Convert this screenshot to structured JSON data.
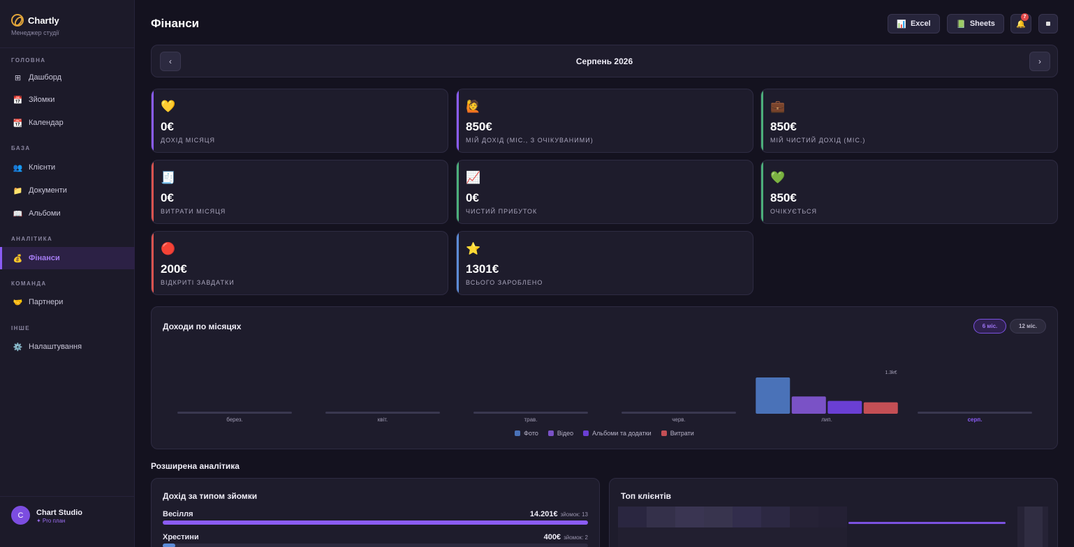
{
  "app": {
    "name": "Chartly",
    "subtitle": "Менеджер студії"
  },
  "nav": {
    "sections": [
      {
        "title": "ГОЛОВНА",
        "items": [
          {
            "key": "dashboard",
            "icon": "⊞",
            "label": "Дашборд"
          },
          {
            "key": "shoots",
            "icon": "📅",
            "label": "Зйомки"
          },
          {
            "key": "calendar",
            "icon": "📆",
            "label": "Календар"
          }
        ]
      },
      {
        "title": "БАЗА",
        "items": [
          {
            "key": "clients",
            "icon": "👥",
            "label": "Клієнти"
          },
          {
            "key": "documents",
            "icon": "📁",
            "label": "Документи"
          },
          {
            "key": "albums",
            "icon": "📖",
            "label": "Альбоми"
          }
        ]
      },
      {
        "title": "АНАЛІТИКА",
        "items": [
          {
            "key": "finance",
            "icon": "💰",
            "label": "Фінанси",
            "active": true
          }
        ]
      },
      {
        "title": "КОМАНДА",
        "items": [
          {
            "key": "partners",
            "icon": "🤝",
            "label": "Партнери"
          }
        ]
      },
      {
        "title": "ІНШЕ",
        "items": [
          {
            "key": "settings",
            "icon": "⚙️",
            "label": "Налаштування"
          }
        ]
      }
    ]
  },
  "user": {
    "initial": "C",
    "name": "Chart Studio",
    "plan": "✦ Pro план"
  },
  "header": {
    "title": "Фінанси",
    "excel_label": "Excel",
    "excel_icon": "📊",
    "sheets_label": "Sheets",
    "sheets_icon": "📗",
    "bell_icon": "🔔",
    "notif_count": "7"
  },
  "month": {
    "label": "Серпень 2026",
    "prev": "‹",
    "next": "›"
  },
  "stats": [
    {
      "emoji": "💛",
      "value": "0€",
      "label": "Дохід місяця",
      "accent": "#8b5cf6"
    },
    {
      "emoji": "🙋",
      "value": "850€",
      "label": "Мій дохід (міс., з очікуваними)",
      "accent": "#8b5cf6"
    },
    {
      "emoji": "💼",
      "value": "850€",
      "label": "Мій чистий дохід (міс.)",
      "accent": "#4caf7a"
    },
    {
      "emoji": "🧾",
      "value": "0€",
      "label": "Витрати місяця",
      "accent": "#d9534f"
    },
    {
      "emoji": "📈",
      "value": "0€",
      "label": "Чистий прибуток",
      "accent": "#4caf7a"
    },
    {
      "emoji": "💚",
      "value": "850€",
      "label": "Очікується",
      "accent": "#4caf7a"
    },
    {
      "emoji": "🔴",
      "value": "200€",
      "label": "Відкриті завдатки",
      "accent": "#d9534f"
    },
    {
      "emoji": "⭐",
      "value": "1301€",
      "label": "Всього зароблено",
      "accent": "#5b8bd6"
    }
  ],
  "income_chart": {
    "title": "Доходи по місяцях",
    "toggle_6": "6 міс.",
    "toggle_12": "12 міс.",
    "active_month_color": "#8b5cf6"
  },
  "chart_data": {
    "type": "bar",
    "title": "Доходи по місяцях",
    "categories": [
      "берез.",
      "квіт.",
      "трав.",
      "черв.",
      "лип.",
      "серп."
    ],
    "series": [
      {
        "name": "Фото",
        "color": "#4a72b8",
        "values": [
          0,
          0,
          0,
          0,
          651,
          0
        ]
      },
      {
        "name": "Відео",
        "color": "#7a52c6",
        "values": [
          0,
          0,
          0,
          0,
          310,
          0
        ]
      },
      {
        "name": "Альбоми та додатки",
        "color": "#6a3fd4",
        "values": [
          0,
          0,
          0,
          0,
          230,
          0
        ]
      },
      {
        "name": "Витрати",
        "color": "#c44f55",
        "values": [
          0,
          0,
          0,
          0,
          205,
          0
        ]
      }
    ],
    "data_labels": [
      "",
      "",
      "",
      "",
      "1.3k€",
      ""
    ],
    "highlight_category": "серп.",
    "ylim": [
      0,
      651
    ]
  },
  "analytics": {
    "title": "Розширена аналітика",
    "by_type": {
      "title": "Дохід за типом зйомки",
      "rows": [
        {
          "name": "Весілля",
          "amount": "14.201€",
          "count": "зйомок: 13",
          "fraction": 1.0,
          "color": "#8b5cf6"
        },
        {
          "name": "Хрестини",
          "amount": "400€",
          "count": "зйомок: 2",
          "fraction": 0.03,
          "color": "#5b8bd6"
        }
      ]
    },
    "top_clients": {
      "title": "Топ клієнтів"
    }
  }
}
